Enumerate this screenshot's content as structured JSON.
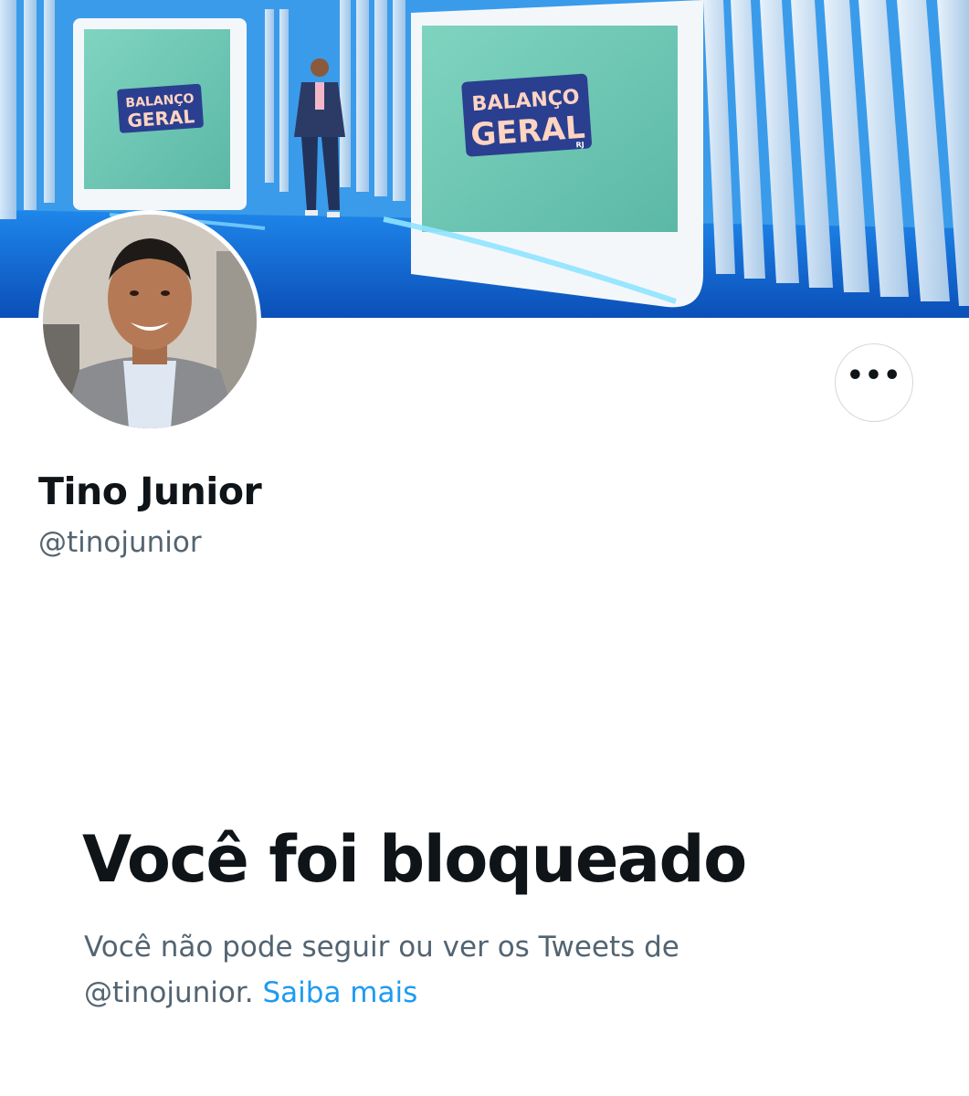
{
  "profile": {
    "display_name": "Tino Junior",
    "handle": "@tinojunior",
    "banner_sign_line1": "BALANÇO",
    "banner_sign_line2": "GERAL",
    "banner_sign_tag": "RJ"
  },
  "actions": {
    "more_icon": "more-horizontal-icon",
    "more_label": "•••"
  },
  "blocked": {
    "title": "Você foi bloqueado",
    "text_line1": "Você não pode seguir ou ver os Tweets de",
    "text_line2": "@tinojunior.",
    "learn_more": "Saiba mais"
  },
  "colors": {
    "text_primary": "#0f1419",
    "text_secondary": "#536471",
    "link": "#1d9bf0",
    "border": "#cfd9de"
  }
}
